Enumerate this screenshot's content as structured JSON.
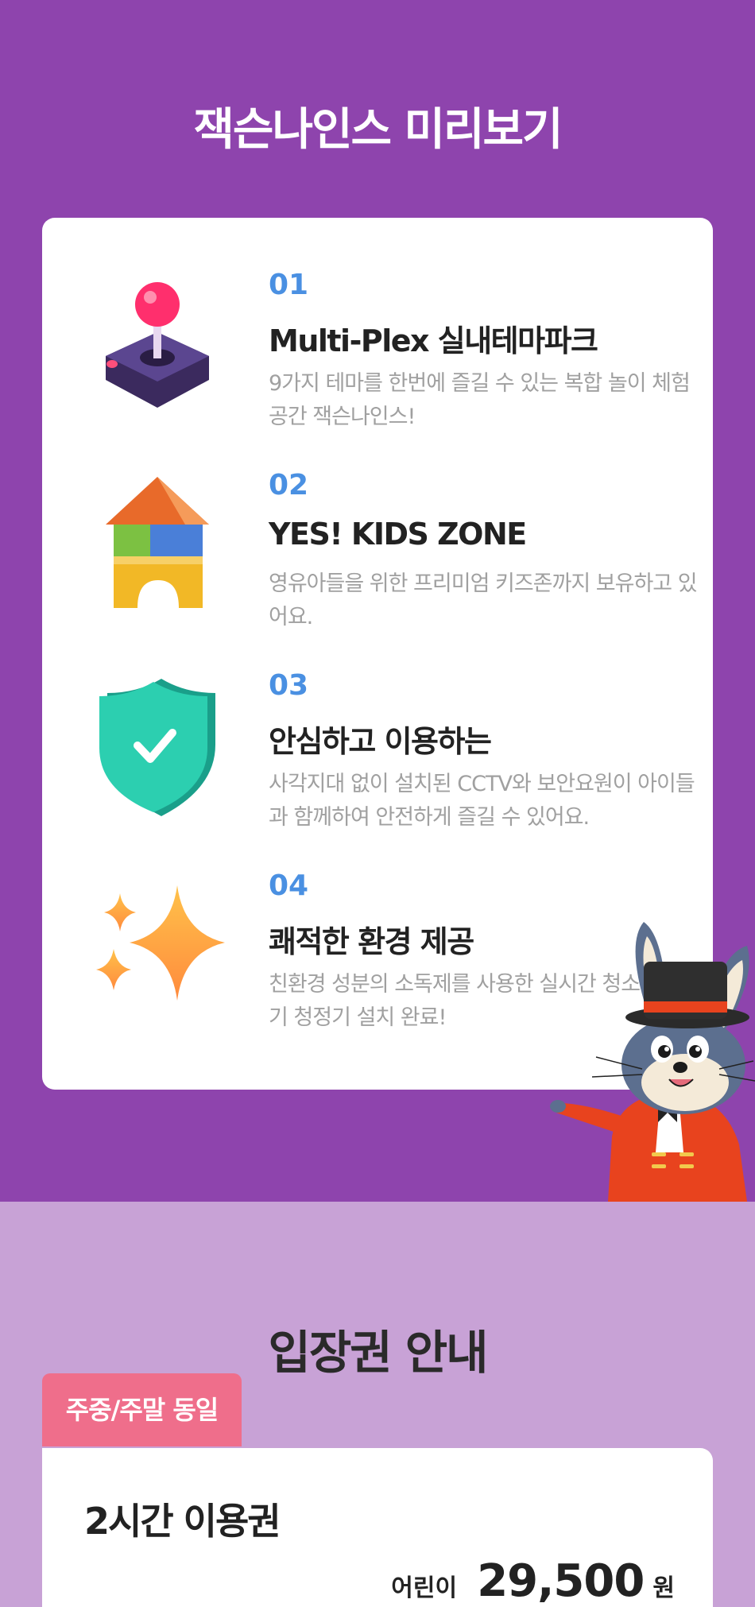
{
  "preview": {
    "title": "잭슨나인스 미리보기",
    "features": [
      {
        "num": "01",
        "title": "Multi-Plex 실내테마파크",
        "desc": "9가지 테마를 한번에 즐길 수 있는 복합 놀이 체험 공간 잭슨나인스!",
        "icon": "joystick-icon"
      },
      {
        "num": "02",
        "title": "YES! KIDS ZONE",
        "desc": "영유아들을 위한 프리미엄 키즈존까지 보유하고 있어요.",
        "icon": "toy-blocks-icon"
      },
      {
        "num": "03",
        "title": "안심하고 이용하는",
        "desc": "사각지대 없이 설치된 CCTV와 보안요원이 아이들과 함께하여 안전하게 즐길 수 있어요.",
        "icon": "shield-check-icon"
      },
      {
        "num": "04",
        "title": "쾌적한 환경 제공",
        "desc": "친환경 성분의 소독제를 사용한 실시간 청소와 공기 청정기 설치 완료!",
        "icon": "sparkles-icon"
      }
    ],
    "mascot": "rabbit-magician-mascot",
    "colors": {
      "background": "#8e44ad",
      "accent_number": "#4a90e2"
    }
  },
  "tickets": {
    "title": "입장권 안내",
    "badge": "주중/주말 동일",
    "items": [
      {
        "name": "2시간 이용권",
        "price_label": "어린이",
        "price": "29,500",
        "unit": "원"
      }
    ],
    "colors": {
      "background": "#c8a2d6",
      "badge": "#ef6e8b"
    }
  }
}
